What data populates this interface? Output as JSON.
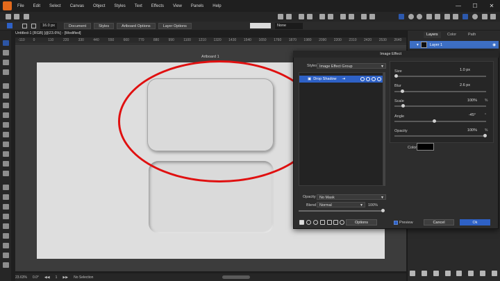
{
  "menu": {
    "items": [
      "File",
      "Edit",
      "Select",
      "Canvas",
      "Object",
      "Styles",
      "Text",
      "Effects",
      "View",
      "Panels",
      "Help"
    ],
    "window_controls": [
      "—",
      "☐",
      "✕"
    ]
  },
  "context_toolbar": {
    "font_size": "16.0 px",
    "document_label": "Document",
    "styles_label": "Styles",
    "artboard_options_label": "Artboard Options",
    "layer_options_label": "Layer Options",
    "blend_value": "None"
  },
  "document": {
    "tab_title": "Untitled-1 [RGB] [@23.6%] - [Modified]",
    "artboard_label": "Artboard 1",
    "ruler_ticks": [
      "-110",
      "0",
      "110",
      "220",
      "330",
      "440",
      "550",
      "660",
      "770",
      "880",
      "990",
      "1100",
      "1210",
      "1320",
      "1430",
      "1540",
      "1650",
      "1760",
      "1870",
      "1980",
      "2090",
      "2200",
      "2310",
      "2420",
      "2530",
      "2640"
    ]
  },
  "statusbar": {
    "zoom": "23.63%",
    "angle": "0.0°",
    "page": "1",
    "selection": "No Selection"
  },
  "layers_panel": {
    "tabs": [
      "Layers",
      "Color",
      "Path"
    ],
    "layer_name": "Layer 1"
  },
  "image_effect_dialog": {
    "title": "Image Effect",
    "styles_label": "Styles",
    "styles_value": "Image Effect Group",
    "effect_name": "Drop Shadow",
    "params": {
      "size_label": "Size",
      "size_value": "1.0 px",
      "blur_label": "Blur",
      "blur_value": "2.6 px",
      "scale_label": "Scale",
      "scale_value": "100%",
      "angle_label": "Angle",
      "angle_value": "-45°",
      "opacity_label": "Opacity",
      "opacity_value": "100%",
      "color_label": "Color",
      "percent_unit": "%",
      "degree_unit": "°"
    },
    "opacity_label": "Opacity",
    "opacity_value": "No Mask",
    "blend_label": "Blend",
    "blend_value": "Normal",
    "blend_percent": "100%",
    "options_label": "Options",
    "preview_label": "Preview",
    "cancel_label": "Cancel",
    "ok_label": "Ok"
  },
  "colors": {
    "accent": "#2e61c6",
    "highlight_ellipse": "#e01010",
    "app_logo": "#e46a1c"
  }
}
